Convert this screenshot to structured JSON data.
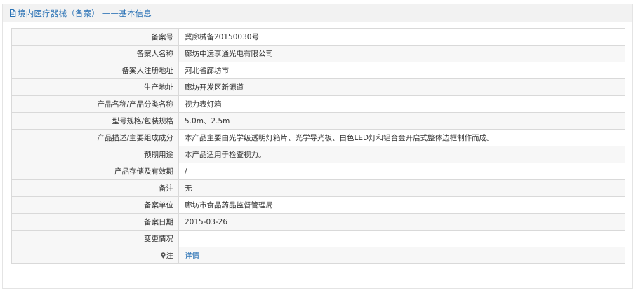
{
  "header": {
    "icon": "document-icon",
    "title": "境内医疗器械（备案） ——基本信息"
  },
  "rows": [
    {
      "label": "备案号",
      "value": "冀廊械备20150030号"
    },
    {
      "label": "备案人名称",
      "value": "廊坊中远享通光电有限公司"
    },
    {
      "label": "备案人注册地址",
      "value": "河北省廊坊市"
    },
    {
      "label": "生产地址",
      "value": "廊坊开发区新源道"
    },
    {
      "label": "产品名称/产品分类名称",
      "value": "视力表灯箱"
    },
    {
      "label": "型号规格/包装规格",
      "value": "5.0m、2.5m"
    },
    {
      "label": "产品描述/主要组成成分",
      "value": "本产品主要由光学级透明灯箱片、光学导光板、白色LED灯和铝合金开启式整体边框制作而成。"
    },
    {
      "label": "预期用途",
      "value": "本产品适用于检查视力。"
    },
    {
      "label": "产品存储及有效期",
      "value": "/"
    },
    {
      "label": "备注",
      "value": "无"
    },
    {
      "label": "备案单位",
      "value": "廊坊市食品药品监督管理局"
    },
    {
      "label": "备案日期",
      "value": "2015-03-26"
    },
    {
      "label": "变更情况",
      "value": ""
    }
  ],
  "note_row": {
    "icon": "map-pin-icon",
    "label": "注",
    "link_text": "详情"
  },
  "colors": {
    "accent": "#2a72b5",
    "label_bg": "#f7f7f7",
    "border": "#d9d9d9"
  }
}
